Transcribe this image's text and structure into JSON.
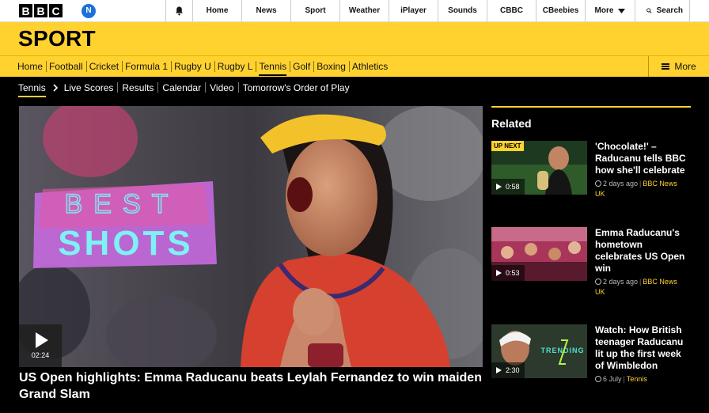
{
  "global_nav": {
    "logo_letters": [
      "B",
      "B",
      "C"
    ],
    "notification_badge": "N",
    "links": [
      "Home",
      "News",
      "Sport",
      "Weather",
      "iPlayer",
      "Sounds",
      "CBBC",
      "CBeebies"
    ],
    "more_label": "More",
    "search_label": "Search",
    "icons": {
      "bell": "bell-icon",
      "more": "chevron-down-icon",
      "search": "search-icon"
    }
  },
  "sport_header": {
    "title": "SPORT"
  },
  "section_nav": {
    "items": [
      "Home",
      "Football",
      "Cricket",
      "Formula 1",
      "Rugby U",
      "Rugby L",
      "Tennis",
      "Golf",
      "Boxing",
      "Athletics"
    ],
    "active": "Tennis",
    "more_label": "More"
  },
  "sub_nav": {
    "current": "Tennis",
    "items": [
      "Live Scores",
      "Results",
      "Calendar",
      "Video",
      "Tomorrow's Order of Play"
    ]
  },
  "hero": {
    "duration": "02:24",
    "overlay_line1": "BEST",
    "overlay_line2": "SHOTS",
    "headline": "US Open highlights: Emma Raducanu beats Leylah Fernandez to win maiden Grand Slam"
  },
  "related": {
    "title": "Related",
    "items": [
      {
        "badge": "UP NEXT",
        "duration": "0:58",
        "headline": "'Chocolate!' – Raducanu tells BBC how she'll celebrate",
        "time": "2 days ago",
        "tag": "BBC News",
        "tag2": "UK"
      },
      {
        "badge": "",
        "duration": "0:53",
        "headline": "Emma Raducanu's hometown celebrates US Open win",
        "time": "2 days ago",
        "tag": "BBC News",
        "tag2": "UK"
      },
      {
        "badge": "",
        "duration": "2:30",
        "headline": "Watch: How British teenager Raducanu lit up the first week of Wimbledon",
        "time": "6 July",
        "tag": "Tennis",
        "tag2": "",
        "thumb_text": "TRENDING"
      }
    ]
  },
  "colors": {
    "brand_yellow": "#ffd230",
    "background": "#000000",
    "text": "#ffffff"
  }
}
